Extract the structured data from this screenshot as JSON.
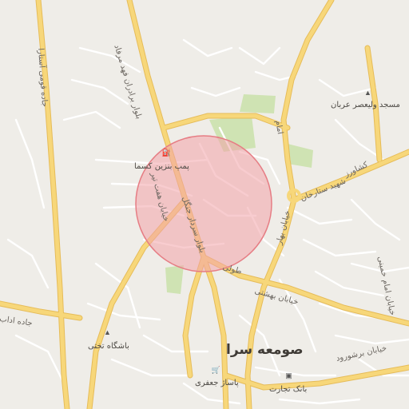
{
  "map": {
    "labels": {
      "road_fahd": "بلوار برادران فهد مرفاد",
      "road_qomi": "جاده قومی آستارا",
      "road_sardar": "بلوار سردار جنگل",
      "road_haft_tir": "خیابان هفت تیر",
      "road_sattarkhan": "شهید ستارخان",
      "road_shahid_beheshti": "خیابان بهشتی",
      "road_golestan": "کشاورز",
      "road_emam": "امام",
      "road_bahar": "خیابان بهار",
      "road_adab": "جاده اداب",
      "road_tolui": "طولی",
      "road_bazar": "خیابان برشورود",
      "road_ali_zade": "خیابان امام خمینی"
    },
    "pois": {
      "gas_station": "پمپ بنزین کسما",
      "mosque": "مسجد ولیعصر عربان",
      "club": "باشگاه تختی",
      "market": "پاساژ جعفری",
      "bank": "بانک تجارت"
    },
    "city_label": "صومعه سرا",
    "radius_circle": {
      "fill": "#f2a3a8",
      "stroke": "#e67d84"
    },
    "colors": {
      "background": "#efede8",
      "major_road": "#f7d77a",
      "major_road_edge": "#e6bc59",
      "minor_road": "#ffffff",
      "park": "#cfe3b3"
    }
  }
}
